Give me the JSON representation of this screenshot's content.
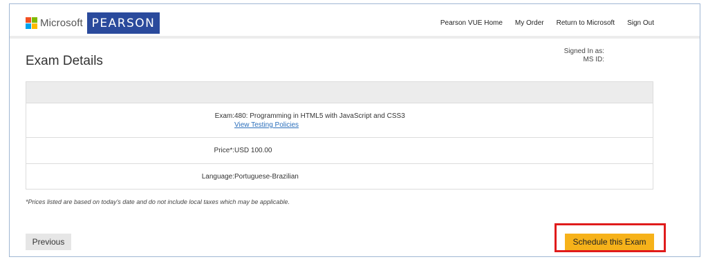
{
  "header": {
    "microsoft_label": "Microsoft",
    "pearson_label": "PEARSON",
    "ms_colors": [
      "#f25022",
      "#7fba00",
      "#00a4ef",
      "#ffb900"
    ],
    "nav": [
      "Pearson VUE Home",
      "My Order",
      "Return to Microsoft",
      "Sign Out"
    ]
  },
  "signed": {
    "signed_in_label": "Signed In as:",
    "ms_id_label": "MS ID:"
  },
  "page_title": "Exam Details",
  "details": {
    "exam_label": "Exam:",
    "exam_value": "480: Programming in HTML5 with JavaScript and CSS3",
    "policies_link": "View Testing Policies",
    "price_label": "Price*:",
    "price_value": "USD 100.00",
    "language_label": "Language:",
    "language_value": "Portuguese-Brazilian"
  },
  "footnote": "*Prices listed are based on today's date and do not include local taxes which may be applicable.",
  "buttons": {
    "previous": "Previous",
    "schedule": "Schedule this Exam"
  },
  "colors": {
    "pearson_blue": "#2a4a9c",
    "schedule_yellow": "#f6b21a",
    "highlight_red": "#e01b1b",
    "link_blue": "#2a6ebb"
  }
}
